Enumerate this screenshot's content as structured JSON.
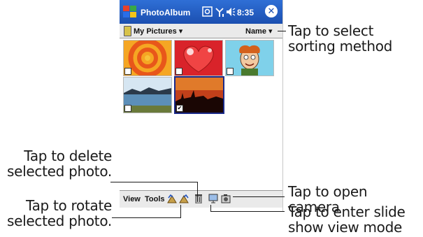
{
  "app": {
    "title": "PhotoAlbum",
    "time": "8:35",
    "folder": "My Pictures",
    "sort": "Name"
  },
  "thumbnails": [
    {
      "name": "orange-rings",
      "checked": false
    },
    {
      "name": "red-heart",
      "checked": false
    },
    {
      "name": "cartoon-character",
      "checked": false
    },
    {
      "name": "lake-landscape",
      "checked": false
    },
    {
      "name": "sunset-silhouette",
      "checked": true
    }
  ],
  "menu": {
    "view": "View",
    "tools": "Tools"
  },
  "annotations": {
    "sort": "Tap to select sorting method",
    "delete_line1": "Tap to delete",
    "delete_line2": "selected photo.",
    "rotate_line1": "Tap to rotate",
    "rotate_line2": "selected photo.",
    "camera": "Tap to open camera",
    "slideshow_line1": "Tap to enter slide",
    "slideshow_line2": "show view mode"
  },
  "colors": {
    "titlebar": "#1b4fb0",
    "selection": "#1a2a8a"
  }
}
